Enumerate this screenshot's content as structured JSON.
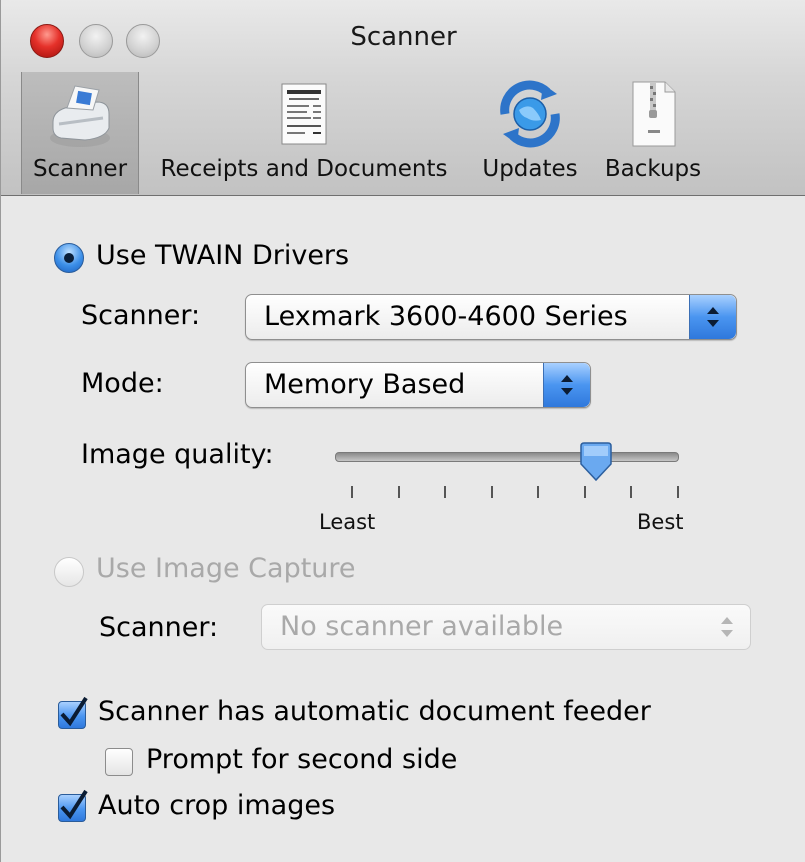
{
  "window": {
    "title": "Scanner"
  },
  "toolbar": {
    "items": [
      {
        "label": "Scanner",
        "icon": "scanner-icon",
        "selected": true
      },
      {
        "label": "Receipts and Documents",
        "icon": "receipt-document-icon",
        "selected": false
      },
      {
        "label": "Updates",
        "icon": "globe-sync-icon",
        "selected": false
      },
      {
        "label": "Backups",
        "icon": "zip-archive-icon",
        "selected": false
      }
    ]
  },
  "twain": {
    "label": "Use TWAIN Drivers",
    "selected": true,
    "scanner_label": "Scanner:",
    "scanner_value": "Lexmark 3600-4600 Series",
    "mode_label": "Mode:",
    "mode_value": "Memory Based",
    "quality_label": "Image quality:",
    "quality_min_label": "Least",
    "quality_max_label": "Best",
    "quality_level": 0.75
  },
  "image_capture": {
    "label": "Use Image Capture",
    "selected": false,
    "scanner_label": "Scanner:",
    "scanner_value": "No scanner available"
  },
  "options": {
    "adf_label": "Scanner has automatic document feeder",
    "adf_checked": true,
    "second_side_label": "Prompt for second side",
    "second_side_checked": false,
    "autocrop_label": "Auto crop images",
    "autocrop_checked": true
  },
  "colors": {
    "accent": "#3c8fe8",
    "close_button": "#e5312a"
  }
}
